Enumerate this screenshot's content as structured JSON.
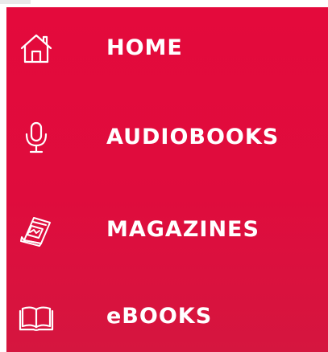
{
  "menu": {
    "accent_color": "#e20b3d",
    "text_color": "#ffffff",
    "items": [
      {
        "label": "HOME",
        "icon": "home-icon"
      },
      {
        "label": "AUDIOBOOKS",
        "icon": "microphone-icon"
      },
      {
        "label": "MAGAZINES",
        "icon": "magazine-icon"
      },
      {
        "label": "eBOOKS",
        "icon": "open-book-icon"
      }
    ]
  }
}
